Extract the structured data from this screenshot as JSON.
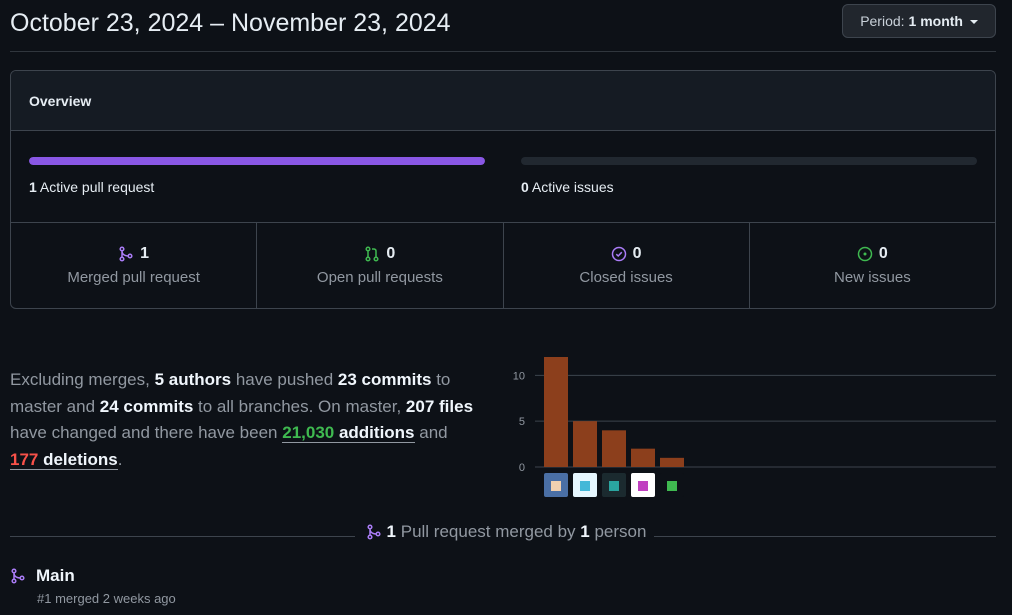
{
  "header": {
    "title": "October 23, 2024 – November 23, 2024",
    "period_label": "Period:",
    "period_value": "1 month"
  },
  "overview": {
    "title": "Overview",
    "pull_requests": {
      "count": "1",
      "label": "Active pull request",
      "progress": 1.0,
      "color": "#8957e5"
    },
    "issues": {
      "count": "0",
      "label": "Active issues",
      "progress": 0
    },
    "stats": [
      {
        "count": "1",
        "label": "Merged pull request",
        "icon": "git-merge-icon",
        "color": "#ab7df8"
      },
      {
        "count": "0",
        "label": "Open pull requests",
        "icon": "git-pull-request-icon",
        "color": "#3fb950"
      },
      {
        "count": "0",
        "label": "Closed issues",
        "icon": "issue-closed-icon",
        "color": "#ab7df8"
      },
      {
        "count": "0",
        "label": "New issues",
        "icon": "issue-opened-icon",
        "color": "#3fb950"
      }
    ]
  },
  "summary": {
    "t1": "Excluding merges, ",
    "authors": "5 authors",
    "t2": " have pushed ",
    "commits_master": "23 commits",
    "t3": " to master and ",
    "commits_all": "24 commits",
    "t4": " to all branches. On master, ",
    "files": "207 files",
    "t5": " have changed and there have been ",
    "additions_num": "21,030",
    "additions_word": " additions",
    "t6": " and ",
    "deletions_num": "177",
    "deletions_word": " deletions",
    "t7": "."
  },
  "chart_data": {
    "type": "bar",
    "categories": [
      "author-1",
      "author-2",
      "author-3",
      "author-4",
      "author-5"
    ],
    "values": [
      12,
      5,
      4,
      2,
      1
    ],
    "yticks": [
      "10",
      "5",
      "0"
    ],
    "ylim": [
      0,
      12
    ],
    "bar_color": "#8c3f1c",
    "grid": true
  },
  "merged_line": {
    "count": "1",
    "text1": " Pull request merged by ",
    "people": "1",
    "text2": " person"
  },
  "pr_item": {
    "title": "Main",
    "subtitle": "#1 merged 2 weeks ago"
  }
}
